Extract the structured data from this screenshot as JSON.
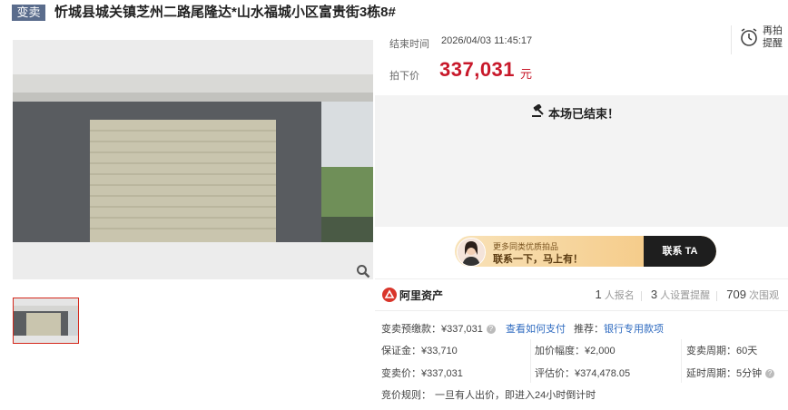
{
  "header": {
    "tag": "变卖",
    "title": "忻城县城关镇芝州二路尾隆达*山水福城小区富贵街3栋8#"
  },
  "auction": {
    "end_time_label": "结束时间",
    "end_time": "2026/04/03 11:45:17",
    "price_label": "拍下价",
    "price": "337,031",
    "price_unit": "元",
    "remind_label": "再拍提醒",
    "ended_message": "本场已结束！"
  },
  "banner": {
    "small_text": "更多同类优质拍品",
    "big_text": "联系一下，马上有！",
    "button_label": "联系 TA"
  },
  "brand": {
    "name": "阿里资产",
    "signup_count": "1",
    "signup_label": "人报名",
    "reminder_count": "3",
    "reminder_label": "人设置提醒",
    "view_count": "709",
    "view_label": "次围观"
  },
  "details": {
    "deposit_pay": "变卖预缴款：¥337,031",
    "how_to_pay": "查看如何支付",
    "recommend_label": "推荐：",
    "bank_loan": "银行专用款项",
    "guarantee": "保证金：¥33,710",
    "increment": "加价幅度：¥2,000",
    "period": "变卖周期：60天",
    "sale_price": "变卖价：¥337,031",
    "appraisal": "评估价：¥374,478.05",
    "delay_period": "延时周期：5分钟",
    "rule": "竞价规则：",
    "rule_text": "一旦有人出价，即进入24小时倒计时"
  },
  "icons": {
    "zoom": "magnifier-icon",
    "remind": "alarm-clock-icon",
    "ended": "gavel-icon",
    "help": "question-icon",
    "brand_logo": "ali-assets-logo"
  },
  "colors": {
    "accent_red": "#c8182a",
    "tag_bg": "#5a6c8c",
    "link_blue": "#2f6bc0"
  }
}
